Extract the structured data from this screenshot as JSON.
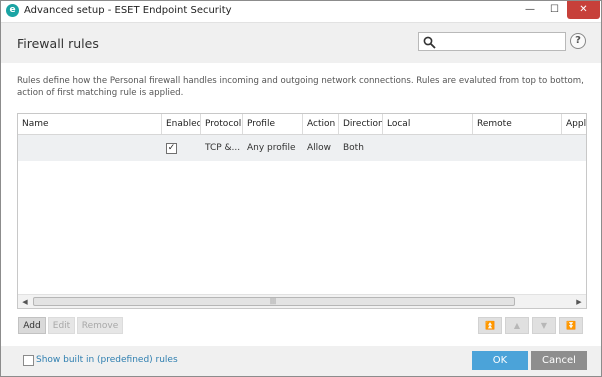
{
  "window": {
    "title": "Advanced setup - ESET Endpoint Security",
    "app_icon_glyph": "e",
    "controls": {
      "minimize": "—",
      "maximize": "☐",
      "close": "✕"
    }
  },
  "header": {
    "title": "Firewall rules",
    "search": {
      "value": "",
      "placeholder": ""
    },
    "help_label": "?"
  },
  "description": "Rules define how the Personal firewall handles incoming and outgoing network connections. Rules are evaluted from top to bottom, action of first matching rule is applied.",
  "table": {
    "columns": [
      "Name",
      "Enabled",
      "Protocol",
      "Profile",
      "Action",
      "Direction",
      "Local",
      "Remote",
      "Appl"
    ],
    "rows": [
      {
        "name": "",
        "enabled": "✓",
        "protocol": "TCP &...",
        "profile": "Any profile",
        "action": "Allow",
        "direction": "Both",
        "local": "",
        "remote": "",
        "application": ""
      }
    ],
    "scroll": {
      "left_arrow": "◀",
      "right_arrow": "▶",
      "grip": "|||"
    }
  },
  "actions": {
    "add": "Add",
    "edit": "Edit",
    "remove": "Remove"
  },
  "move": {
    "top": "⏫",
    "up": "▲",
    "down": "▼",
    "bottom": "⏬"
  },
  "footer": {
    "show_builtin_label": "Show built in (predefined) rules",
    "ok": "OK",
    "cancel": "Cancel"
  },
  "colors": {
    "accent": "#4ba3d9",
    "close": "#c7403a",
    "link": "#2f7fb0",
    "app_icon": "#1aa4a4"
  }
}
